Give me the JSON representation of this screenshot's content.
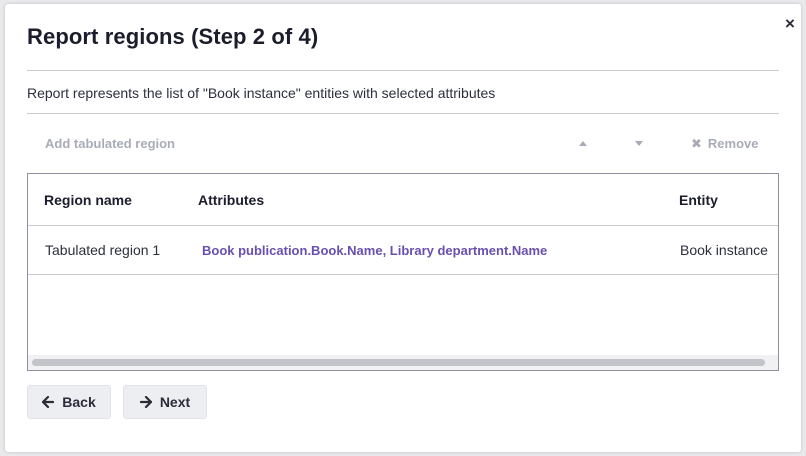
{
  "dialog": {
    "title": "Report regions (Step 2 of 4)",
    "description": "Report represents the list of \"Book instance\" entities with selected attributes",
    "close_icon": "close-icon"
  },
  "toolbar": {
    "add_label": "Add tabulated region",
    "move_up_icon": "triangle-up-icon",
    "move_down_icon": "triangle-down-icon",
    "remove_label": "Remove"
  },
  "table": {
    "columns": [
      "Region name",
      "Attributes",
      "Entity"
    ],
    "rows": [
      {
        "region_name": "Tabulated region 1",
        "attributes": "Book publication.Book.Name, Library department.Name",
        "entity": "Book instance"
      }
    ]
  },
  "footer": {
    "back_label": "Back",
    "next_label": "Next"
  },
  "colors": {
    "link": "#6a4fb0",
    "disabled_text": "#a9acb8",
    "button_bg": "#edeef1"
  }
}
